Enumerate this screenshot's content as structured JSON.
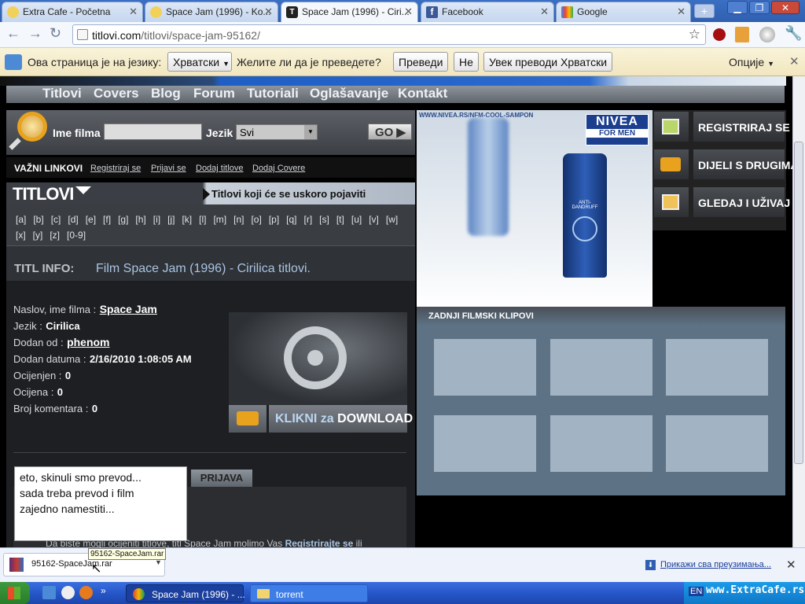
{
  "browser": {
    "tabs": [
      {
        "label": "Extra Cafe - Početna",
        "active": false
      },
      {
        "label": "Space Jam (1996) - Ko...",
        "active": false
      },
      {
        "label": "Space Jam (1996) - Ciri...",
        "active": true
      },
      {
        "label": "Facebook",
        "active": false
      },
      {
        "label": "Google",
        "active": false
      }
    ],
    "url_host": "titlovi.com",
    "url_path": "/titlovi/space-jam-95162/"
  },
  "translate_bar": {
    "prompt": "Ова страница је на језику:",
    "language": "Хрватски",
    "question": "Желите ли да је преведете?",
    "translate_button": "Преведи",
    "no_button": "Не",
    "always_button": "Увек преводи Хрватски",
    "options": "Опције"
  },
  "site": {
    "nav": [
      "Titlovi",
      "Covers",
      "Blog",
      "Forum",
      "Tutoriali",
      "Oglašavanje",
      "Kontakt"
    ],
    "search": {
      "film_label": "Ime filma",
      "film_value": "",
      "lang_label": "Jezik",
      "lang_value": "Svi",
      "go": "GO"
    },
    "important_links": {
      "title": "VAŽNI LINKOVI",
      "items": [
        "Registriraj se",
        "Prijavi se",
        "Dodaj titlove",
        "Dodaj Covere"
      ]
    },
    "titlovi_header": "TITLOVI",
    "coming_soon": "Titlovi koji će se uskoro pojaviti",
    "letters": [
      "[a]",
      "[b]",
      "[c]",
      "[d]",
      "[e]",
      "[f]",
      "[g]",
      "[h]",
      "[i]",
      "[j]",
      "[k]",
      "[l]",
      "[m]",
      "[n]",
      "[o]",
      "[p]",
      "[q]",
      "[r]",
      "[s]",
      "[t]",
      "[u]",
      "[v]",
      "[w]",
      "[x]",
      "[y]",
      "[z]",
      "[0-9]"
    ],
    "titl_info_label": "TITL INFO:",
    "titl_info_text": "Film Space Jam (1996) - Cirilica titlovi.",
    "info": {
      "naslov_label": "Naslov, ime filma :",
      "naslov_value": "Space Jam",
      "jezik_label": "Jezik :",
      "jezik_value": "Cirilica",
      "dodan_od_label": "Dodan od :",
      "dodan_od_value": "phenom",
      "datum_label": "Dodan datuma :",
      "datum_value": "2/16/2010 1:08:05 AM",
      "ocijenjen_label": "Ocijenjen :",
      "ocijenjen_value": "0",
      "ocijena_label": "Ocijena :",
      "ocijena_value": "0",
      "komentari_label": "Broj komentara :",
      "komentari_value": "0"
    },
    "download_button": {
      "part1": "KLIKNI",
      "part2": "za",
      "part3": "DOWNLOAD"
    },
    "prijava_tab": "PRIJAVA",
    "bottom_note": "Da biste mogli ocijeniti titlove, titl Space Jam molimo Vas",
    "bottom_note_link": "Registrirajte se",
    "bottom_note_tail": "ili",
    "ad": {
      "url": "WWW.NIVEA.RS/NFM-COOL-SAMPON",
      "brand": "NIVEA",
      "sub": "FOR MEN",
      "bottle_text": "ANTI-DANDRUFF"
    },
    "side_buttons": [
      "REGISTRIRAJ SE",
      "DIJELI S DRUGIMA",
      "GLEDAJ I UŽIVAJ"
    ],
    "clips_title": "ZADNJI FILMSKI KLIPOVI"
  },
  "note_popup": [
    "eto, skinuli smo prevod...",
    "sada treba prevod i film",
    "zajedno namestiti..."
  ],
  "downloads": {
    "file": "95162-SpaceJam.rar",
    "tooltip": "95162-SpaceJam.rar",
    "show_all": "Прикажи сва преузимања..."
  },
  "taskbar": {
    "tasks": [
      "Space Jam (1996) - ...",
      "torrent"
    ],
    "lang": "EN",
    "watermark": "www.ExtraCafe.rs"
  },
  "colors": {
    "tab_bar": "#2f5fb0",
    "page_bg": "#000000",
    "panel": "#2b2d30",
    "clips_panel": "#5d7285",
    "taskbar": "#2353c4"
  }
}
